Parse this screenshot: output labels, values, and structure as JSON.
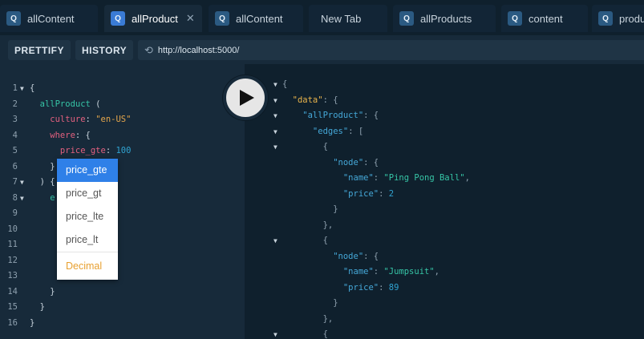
{
  "tabs": [
    {
      "label": "allContent",
      "active": false,
      "has_icon": true
    },
    {
      "label": "allProduct",
      "active": true,
      "has_icon": true
    },
    {
      "label": "allContent",
      "active": false,
      "has_icon": true
    },
    {
      "label": "New Tab",
      "active": false,
      "has_icon": false
    },
    {
      "label": "allProducts",
      "active": false,
      "has_icon": true
    },
    {
      "label": "content",
      "active": false,
      "has_icon": true
    },
    {
      "label": "produ",
      "active": false,
      "has_icon": true
    }
  ],
  "tab_icon_letter": "Q",
  "tab_close_glyph": "✕",
  "toolbar": {
    "prettify": "PRETTIFY",
    "history": "HISTORY",
    "url": "http://localhost:5000/"
  },
  "query_lines": [
    {
      "n": "1",
      "tokens": [
        {
          "c": "k-plain",
          "t": "{"
        }
      ]
    },
    {
      "n": "2",
      "tokens": [
        {
          "c": "k-field",
          "t": "  allProduct"
        },
        {
          "c": "k-plain",
          "t": " ("
        }
      ]
    },
    {
      "n": "3",
      "tokens": [
        {
          "c": "k-arg",
          "t": "    culture"
        },
        {
          "c": "k-plain",
          "t": ": "
        },
        {
          "c": "k-str",
          "t": "\"en-US\""
        }
      ]
    },
    {
      "n": "4",
      "tokens": [
        {
          "c": "k-arg",
          "t": "    where"
        },
        {
          "c": "k-plain",
          "t": ": {"
        }
      ]
    },
    {
      "n": "5",
      "tokens": [
        {
          "c": "k-arg",
          "t": "      price_gte"
        },
        {
          "c": "k-plain",
          "t": ": "
        },
        {
          "c": "k-num",
          "t": "100"
        }
      ]
    },
    {
      "n": "6",
      "tokens": [
        {
          "c": "k-plain",
          "t": "    }"
        }
      ]
    },
    {
      "n": "7",
      "tokens": [
        {
          "c": "k-plain",
          "t": "  ) {"
        }
      ]
    },
    {
      "n": "8",
      "tokens": [
        {
          "c": "k-field",
          "t": "    e"
        }
      ]
    },
    {
      "n": "9",
      "tokens": []
    },
    {
      "n": "10",
      "tokens": []
    },
    {
      "n": "11",
      "tokens": []
    },
    {
      "n": "12",
      "tokens": []
    },
    {
      "n": "13",
      "tokens": []
    },
    {
      "n": "14",
      "tokens": [
        {
          "c": "k-plain",
          "t": "    }"
        }
      ]
    },
    {
      "n": "15",
      "tokens": [
        {
          "c": "k-plain",
          "t": "  }"
        }
      ]
    },
    {
      "n": "16",
      "tokens": [
        {
          "c": "k-plain",
          "t": "}"
        }
      ]
    }
  ],
  "autocomplete": {
    "options": [
      "price_gte",
      "price_gt",
      "price_lte",
      "price_lt"
    ],
    "selected_index": 0,
    "type_hint": "Decimal"
  },
  "result_lines": [
    {
      "fold": true,
      "tokens": [
        {
          "c": "r-plain",
          "t": "{"
        }
      ]
    },
    {
      "fold": true,
      "tokens": [
        {
          "c": "r-key",
          "t": "  \"data\""
        },
        {
          "c": "r-plain",
          "t": ": {"
        }
      ]
    },
    {
      "fold": true,
      "tokens": [
        {
          "c": "r-key2",
          "t": "    \"allProduct\""
        },
        {
          "c": "r-plain",
          "t": ": {"
        }
      ]
    },
    {
      "fold": true,
      "tokens": [
        {
          "c": "r-key2",
          "t": "      \"edges\""
        },
        {
          "c": "r-plain",
          "t": ": ["
        }
      ]
    },
    {
      "fold": true,
      "tokens": [
        {
          "c": "r-plain",
          "t": "        {"
        }
      ]
    },
    {
      "fold": false,
      "tokens": [
        {
          "c": "r-key2",
          "t": "          \"node\""
        },
        {
          "c": "r-plain",
          "t": ": {"
        }
      ]
    },
    {
      "fold": false,
      "tokens": [
        {
          "c": "r-key2",
          "t": "            \"name\""
        },
        {
          "c": "r-plain",
          "t": ": "
        },
        {
          "c": "r-str",
          "t": "\"Ping Pong Ball\""
        },
        {
          "c": "r-plain",
          "t": ","
        }
      ]
    },
    {
      "fold": false,
      "tokens": [
        {
          "c": "r-key2",
          "t": "            \"price\""
        },
        {
          "c": "r-plain",
          "t": ": "
        },
        {
          "c": "r-num",
          "t": "2"
        }
      ]
    },
    {
      "fold": false,
      "tokens": [
        {
          "c": "r-plain",
          "t": "          }"
        }
      ]
    },
    {
      "fold": false,
      "tokens": [
        {
          "c": "r-plain",
          "t": "        },"
        }
      ]
    },
    {
      "fold": true,
      "tokens": [
        {
          "c": "r-plain",
          "t": "        {"
        }
      ]
    },
    {
      "fold": false,
      "tokens": [
        {
          "c": "r-key2",
          "t": "          \"node\""
        },
        {
          "c": "r-plain",
          "t": ": {"
        }
      ]
    },
    {
      "fold": false,
      "tokens": [
        {
          "c": "r-key2",
          "t": "            \"name\""
        },
        {
          "c": "r-plain",
          "t": ": "
        },
        {
          "c": "r-str",
          "t": "\"Jumpsuit\""
        },
        {
          "c": "r-plain",
          "t": ","
        }
      ]
    },
    {
      "fold": false,
      "tokens": [
        {
          "c": "r-key2",
          "t": "            \"price\""
        },
        {
          "c": "r-plain",
          "t": ": "
        },
        {
          "c": "r-num",
          "t": "89"
        }
      ]
    },
    {
      "fold": false,
      "tokens": [
        {
          "c": "r-plain",
          "t": "          }"
        }
      ]
    },
    {
      "fold": false,
      "tokens": [
        {
          "c": "r-plain",
          "t": "        },"
        }
      ]
    },
    {
      "fold": true,
      "tokens": [
        {
          "c": "r-plain",
          "t": "        {"
        }
      ]
    }
  ]
}
